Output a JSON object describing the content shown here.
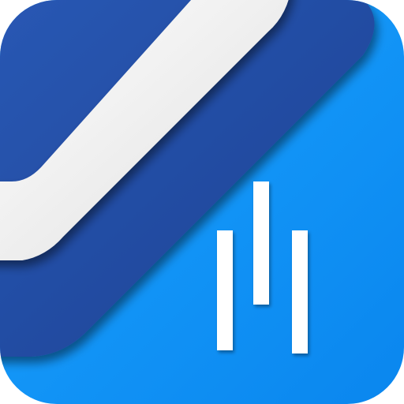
{
  "app_icon": {
    "icon": "chart-bars-icon",
    "colors": {
      "background": "#0a8cf2",
      "background_light": "#19a0ff",
      "band": "#214ea8",
      "band_dark": "#1a3f8c",
      "stroke": "#f2f2f2",
      "stroke_shadow": "#c8c8c8",
      "bars": "#ffffff"
    },
    "bars": [
      {
        "name": "left",
        "level": 0.62
      },
      {
        "name": "middle",
        "level": 0.78
      },
      {
        "name": "right",
        "level": 0.62
      }
    ]
  }
}
